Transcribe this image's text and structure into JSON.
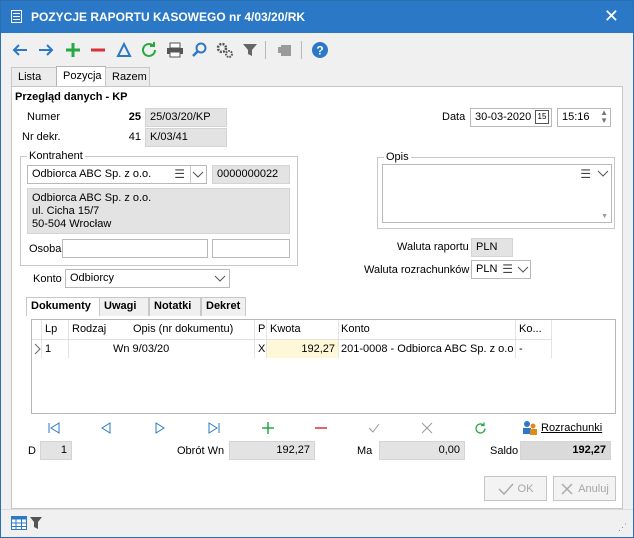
{
  "window": {
    "title": "POZYCJE RAPORTU KASOWEGO nr 4/03/20/RK"
  },
  "tabs": [
    "Lista",
    "Pozycja",
    "Razem"
  ],
  "section": {
    "title": "Przegląd danych - KP"
  },
  "numer": {
    "label": "Numer",
    "value": "25",
    "ref": "25/03/20/KP"
  },
  "nrdekr": {
    "label": "Nr dekr.",
    "value": "41",
    "ref": "K/03/41"
  },
  "data": {
    "label": "Data",
    "date": "30-03-2020",
    "cal": "15",
    "time": "15:16"
  },
  "kontrahent": {
    "title": "Kontrahent",
    "name": "Odbiorca ABC Sp. z o.o.",
    "code": "0000000022",
    "addr1": "Odbiorca ABC Sp. z o.o.",
    "addr2": "ul. Cicha 15/7",
    "addr3": "50-504 Wrocław",
    "osoba_label": "Osoba"
  },
  "opis": {
    "title": "Opis"
  },
  "waluta": {
    "raportu_label": "Waluta raportu",
    "raportu": "PLN",
    "rozrach_label": "Waluta rozrachunków",
    "rozrach": "PLN"
  },
  "konto": {
    "label": "Konto",
    "value": "Odbiorcy"
  },
  "subtabs": [
    "Dokumenty",
    "Uwagi",
    "Notatki",
    "Dekret"
  ],
  "grid": {
    "headers": [
      "Lp",
      "Rodzaj",
      "Opis (nr dokumentu)",
      "P",
      "Kwota",
      "Konto",
      "Ko..."
    ],
    "row": {
      "lp": "1",
      "rodzaj": "",
      "opis": "Wn 9/03/20",
      "p": "X",
      "kwota": "192,27",
      "konto": "201-0008 - Odbiorca ABC Sp. z o.o.",
      "ko": "-"
    }
  },
  "rozrachunki": "Rozrachunki",
  "totals": {
    "d_label": "D",
    "d_value": "1",
    "obrot_label": "Obrót Wn",
    "obrot_value": "192,27",
    "ma_label": "Ma",
    "ma_value": "0,00",
    "saldo_label": "Saldo",
    "saldo_value": "192,27"
  },
  "buttons": {
    "ok": "OK",
    "anuluj": "Anuluj"
  },
  "colors": {
    "title_bg": "#2b78c6",
    "toolbar_blue": "#2b78c6",
    "green": "#28a745",
    "red": "#d9303a",
    "highlight": "#fff8d8"
  }
}
